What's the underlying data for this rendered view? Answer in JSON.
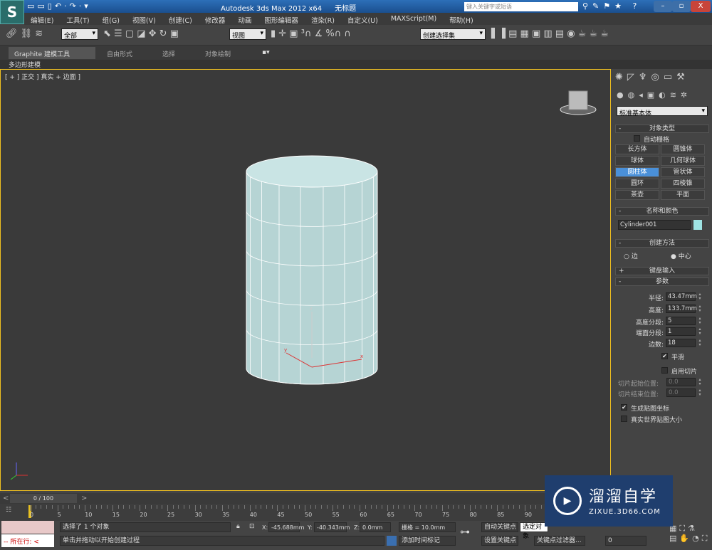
{
  "title": {
    "app": "Autodesk 3ds Max  2012 x64",
    "doc": "无标题",
    "search_placeholder": "键入关键字或短语",
    "logo": "S"
  },
  "menu": [
    "编辑(E)",
    "工具(T)",
    "组(G)",
    "视图(V)",
    "创建(C)",
    "修改器",
    "动画",
    "图形编辑器",
    "渲染(R)",
    "自定义(U)",
    "MAXScript(M)",
    "帮助(H)"
  ],
  "toolbar": {
    "selection_filter": "全部",
    "ref_coord": "视图",
    "named_selection": "创建选择集"
  },
  "ribbon": {
    "tabs": [
      "Graphite 建模工具",
      "自由形式",
      "选择",
      "对象绘制"
    ],
    "sub": "多边形建模"
  },
  "viewport": {
    "label": "[ + ] 正交 ] 真实 + 边面 ]"
  },
  "cmd": {
    "category": "标准基本体",
    "object_type": {
      "title": "对象类型",
      "auto_grid": "自动栅格",
      "buttons": [
        "长方体",
        "圆锥体",
        "球体",
        "几何球体",
        "圆柱体",
        "管状体",
        "圆环",
        "四棱锥",
        "茶壶",
        "平面"
      ],
      "selected": "圆柱体"
    },
    "name_color": {
      "title": "名称和颜色",
      "name": "Cylinder001",
      "color": "#9fe3e3"
    },
    "creation": {
      "title": "创建方法",
      "options": [
        "边",
        "中心"
      ],
      "selected": "中心"
    },
    "keyboard": {
      "title": "键盘输入"
    },
    "params": {
      "title": "参数",
      "radius_label": "半径:",
      "radius": "43.47mm",
      "height_label": "高度:",
      "height": "133.7mm",
      "hseg_label": "高度分段:",
      "hseg": "5",
      "cseg_label": "端面分段:",
      "cseg": "1",
      "sides_label": "边数:",
      "sides": "18",
      "smooth": "平滑",
      "smooth_checked": true,
      "slice": "启用切片",
      "slice_checked": false,
      "slice_from_label": "切片起始位置:",
      "slice_from": "0.0",
      "slice_to_label": "切片结束位置:",
      "slice_to": "0.0",
      "gen_map": "生成贴图坐标",
      "gen_map_checked": true,
      "real_world": "真实世界贴图大小",
      "real_world_checked": false
    }
  },
  "timeline": {
    "frame": "0 / 100",
    "ticks": [
      "0",
      "5",
      "10",
      "15",
      "20",
      "25",
      "30",
      "35",
      "40",
      "45",
      "50",
      "55",
      "60",
      "65",
      "70",
      "75",
      "80",
      "85",
      "90"
    ]
  },
  "status": {
    "selected": "选择了 1 个对象",
    "prompt": "单击并拖动以开始创建过程",
    "x_label": "X:",
    "x": "-45.688mm",
    "y_label": "Y:",
    "y": "-40.343mm",
    "z_label": "Z:",
    "z": "0.0mm",
    "grid": "栅格 = 10.0mm",
    "add_tag": "添加时间标记",
    "auto_key": "自动关键点",
    "set_key": "设置关键点",
    "selected_obj": "选定对象",
    "key_filter": "关键点过滤器...",
    "frame_value": "0",
    "listener": "所在行:"
  },
  "watermark": {
    "brand": "溜溜自学",
    "url": "ZIXUE.3D66.COM"
  }
}
